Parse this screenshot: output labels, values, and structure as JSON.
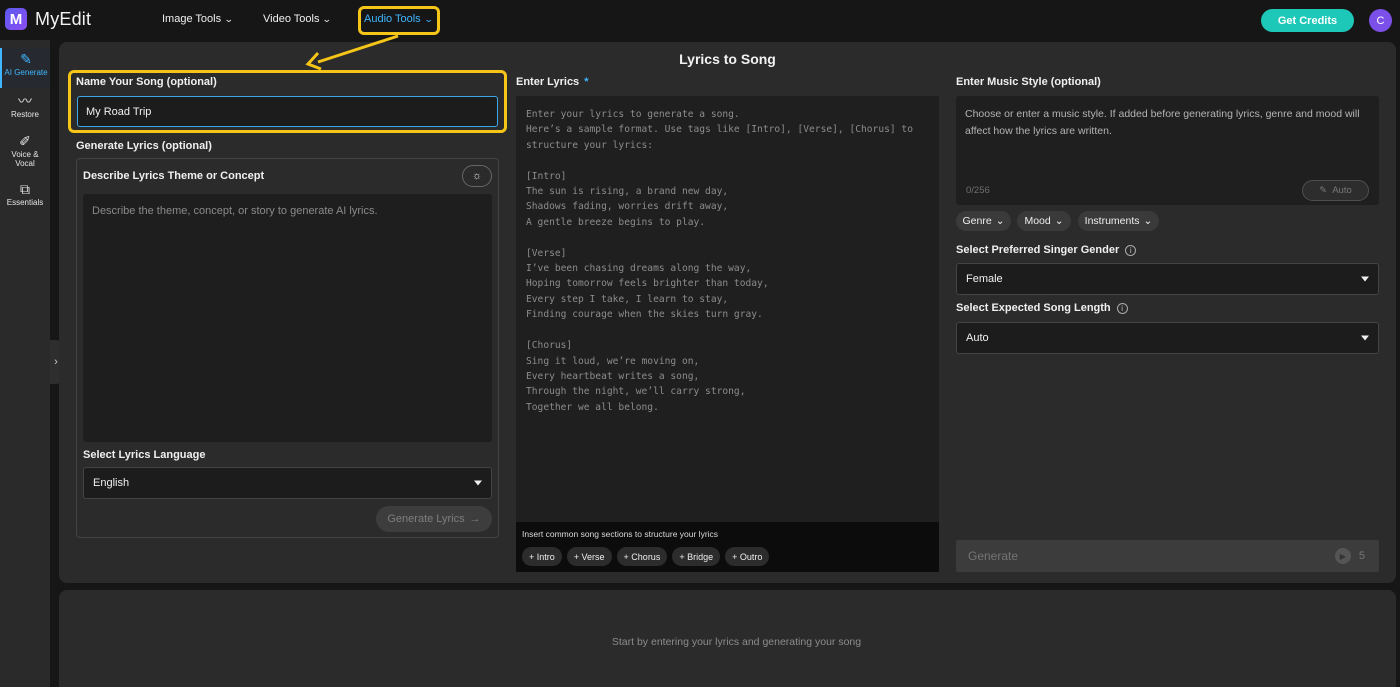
{
  "app": {
    "name": "MyEdit",
    "logo_letter": "M"
  },
  "nav": {
    "items": [
      {
        "label": "Image Tools"
      },
      {
        "label": "Video Tools"
      },
      {
        "label": "Audio Tools",
        "active": true
      }
    ],
    "credits_label": "Get Credits",
    "avatar_letter": "C",
    "accent_color": "#3fb6ff",
    "highlight_color": "#f5c518"
  },
  "sidebar": {
    "items": [
      {
        "label": "AI Generate",
        "icon": "magic-wand-icon",
        "active": true
      },
      {
        "label": "Restore",
        "icon": "waveform-icon"
      },
      {
        "label_line1": "Voice &",
        "label_line2": "Vocal",
        "icon": "wand-mic-icon"
      },
      {
        "label": "Essentials",
        "icon": "layers-icon"
      }
    ]
  },
  "page": {
    "title": "Lyrics to Song"
  },
  "song_name": {
    "label": "Name Your Song (optional)",
    "value": "My Road Trip"
  },
  "generate_lyrics": {
    "label": "Generate Lyrics (optional)",
    "theme_label": "Describe Lyrics Theme or Concept",
    "theme_placeholder": "Describe the theme, concept, or story to generate AI lyrics.",
    "language_label": "Select Lyrics Language",
    "language_value": "English",
    "button_label": "Generate Lyrics"
  },
  "lyrics": {
    "label": "Enter Lyrics",
    "required_mark": "*",
    "placeholder": "Enter your lyrics to generate a song.\nHere’s a sample format. Use tags like [Intro], [Verse], [Chorus] to\nstructure your lyrics:\n\n[Intro]\nThe sun is rising, a brand new day,\nShadows fading, worries drift away,\nA gentle breeze begins to play.\n\n[Verse]\nI’ve been chasing dreams along the way,\nHoping tomorrow feels brighter than today,\nEvery step I take, I learn to stay,\nFinding courage when the skies turn gray.\n\n[Chorus]\nSing it loud, we’re moving on,\nEvery heartbeat writes a song,\nThrough the night, we’ll carry strong,\nTogether we all belong.",
    "sections_hint": "Insert common song sections to structure your lyrics",
    "sections": [
      "+ Intro",
      "+ Verse",
      "+ Chorus",
      "+ Bridge",
      "+ Outro"
    ]
  },
  "music_style": {
    "label": "Enter Music Style (optional)",
    "placeholder": "Choose or enter a music style. If added before generating lyrics, genre and mood will affect how the lyrics are written.",
    "counter": "0/256",
    "auto_label": "Auto",
    "tags": [
      "Genre",
      "Mood",
      "Instruments"
    ]
  },
  "singer_gender": {
    "label": "Select Preferred Singer Gender",
    "value": "Female"
  },
  "song_length": {
    "label": "Select Expected Song Length",
    "value": "Auto"
  },
  "generate": {
    "label": "Generate",
    "cost": "5"
  },
  "output": {
    "empty_text": "Start by entering your lyrics and generating your song"
  }
}
